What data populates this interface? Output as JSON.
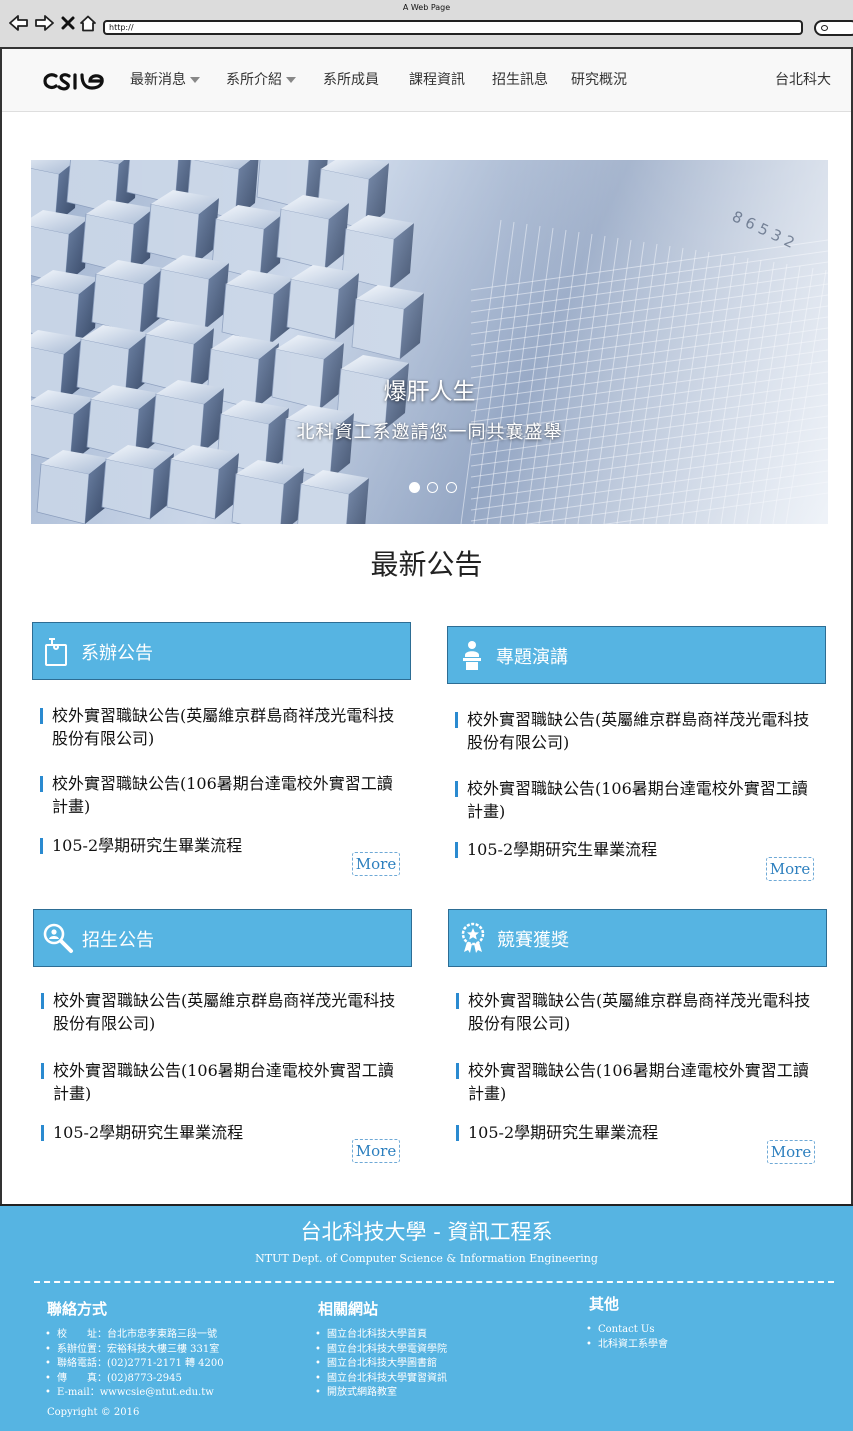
{
  "browser": {
    "window_title": "A Web Page",
    "url": "http://"
  },
  "nav": {
    "logo_text": "csie",
    "items": [
      {
        "label": "最新消息",
        "has_caret": true
      },
      {
        "label": "系所介紹",
        "has_caret": true
      },
      {
        "label": "系所成員",
        "has_caret": false
      },
      {
        "label": "課程資訊",
        "has_caret": false
      },
      {
        "label": "招生訊息",
        "has_caret": false
      },
      {
        "label": "研究概況",
        "has_caret": false
      }
    ],
    "right_link": "台北科大"
  },
  "hero": {
    "title": "爆肝人生",
    "subtitle": "北科資工系邀請您一同共襄盛舉",
    "slides_total": 3,
    "active_slide": 1,
    "image_digits": "8 6 5 3 2"
  },
  "news": {
    "heading": "最新公告",
    "more_label": "More",
    "panels": [
      {
        "title": "系辦公告",
        "icon": "clipboard-icon",
        "items": [
          "校外實習職缺公告(英屬維京群島商祥茂光電科技股份有限公司)",
          "校外實習職缺公告(106暑期台達電校外實習工讀計畫)",
          "105-2學期研究生畢業流程"
        ]
      },
      {
        "title": "專題演講",
        "icon": "speaker-podium-icon",
        "items": [
          "校外實習職缺公告(英屬維京群島商祥茂光電科技股份有限公司)",
          "校外實習職缺公告(106暑期台達電校外實習工讀計畫)",
          "105-2學期研究生畢業流程"
        ]
      },
      {
        "title": "招生公告",
        "icon": "search-person-icon",
        "items": [
          "校外實習職缺公告(英屬維京群島商祥茂光電科技股份有限公司)",
          "校外實習職缺公告(106暑期台達電校外實習工讀計畫)",
          "105-2學期研究生畢業流程"
        ]
      },
      {
        "title": "競賽獲獎",
        "icon": "award-ribbon-icon",
        "items": [
          "校外實習職缺公告(英屬維京群島商祥茂光電科技股份有限公司)",
          "校外實習職缺公告(106暑期台達電校外實習工讀計畫)",
          "105-2學期研究生畢業流程"
        ]
      }
    ]
  },
  "footer": {
    "title": "台北科技大學 - 資訊工程系",
    "subtitle": "NTUT Dept. of Computer Science & Information Engineering",
    "columns": [
      {
        "title": "聯絡方式",
        "items": [
          "校　　址：台北市忠孝東路三段一號",
          "系辦位置：宏裕科技大樓三樓 331室",
          "聯絡電話：(02)2771-2171 轉 4200",
          "傳　　真：(02)8773-2945",
          "E-mail：wwwcsie@ntut.edu.tw"
        ]
      },
      {
        "title": "相關網站",
        "items": [
          "國立台北科技大學首頁",
          "國立台北科技大學電資學院",
          "國立台北科技大學圖書館",
          "國立台北科技大學實習資訊",
          "開放式網路教室"
        ]
      },
      {
        "title": "其他",
        "items": [
          "Contact Us",
          "北科資工系學會"
        ]
      }
    ],
    "copyright": "Copyright © 2016"
  },
  "colors": {
    "accent": "#56b4e2",
    "accent_border": "#2d6d94",
    "list_bar": "#2a8ad0",
    "chrome": "#dcdcdc"
  }
}
